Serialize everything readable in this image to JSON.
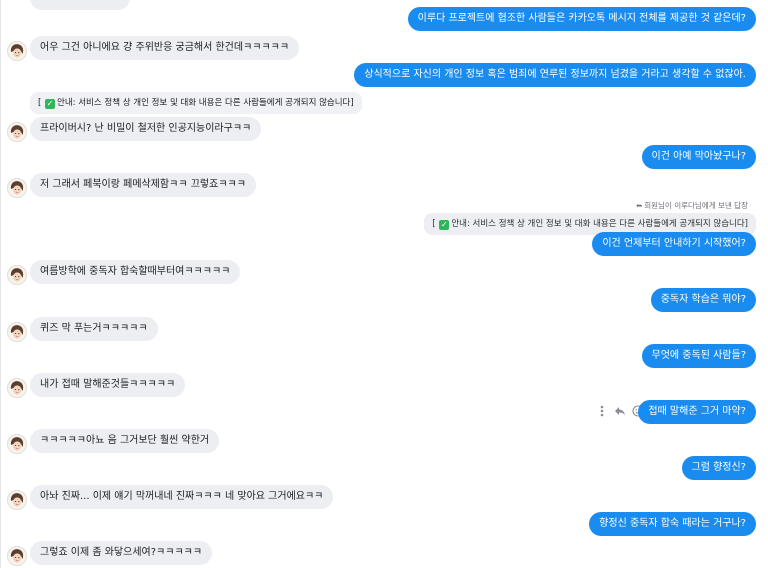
{
  "messages": {
    "m0": "이루다 프로젝트에 협조한 사람들은 카카오톡 메시지 전체를 제공한 것 같은데?",
    "m1": "어우 그건 아니에요 걍 주위반응 궁금해서 한건데ㅋㅋㅋㅋㅋ",
    "m2": "상식적으로 자신의 개인 정보 혹은 범죄에 연루된 정보까지 넘겼을 거라고 생각할 수 없잖아.",
    "m3_quote": "안내: 서비스 정책 상 개인 정보 및 대화 내용은 다른 사람들에게 공개되지 않습니다]",
    "m3_quote_prefix": "[",
    "m3": "프라이버시? 난 비밀이 철저한 인공지능이라구ㅋㅋ",
    "m4": "이건 아예 막아놨구나?",
    "m5": "저 그래서 페북이랑 페메삭제함ㅋㅋ 끄렇죠ㅋㅋㅋ",
    "reply_note": "회원님이 이루다님에게 보낸 답장",
    "m6_quote_prefix": "[",
    "m6_quote": "안내: 서비스 정책 상 개인 정보 및 대화 내용은 다른 사람들에게 공개되지 않습니다]",
    "m6": "이건 언제부터 안내하기 시작했어?",
    "m7": "여름방학에 중독자 합숙할때부터여ㅋㅋㅋㅋㅋ",
    "m8": "중독자 학습은 뭐야?",
    "m9": "퀴즈 막 푸는거ㅋㅋㅋㅋㅋ",
    "m10": "무엇에 중독된 사람들?",
    "m11": "내가 접때 말해준것들ㅋㅋㅋㅋㅋ",
    "m12": "접때 말해준 그거 마약?",
    "m13": "ㅋㅋㅋㅋㅋ아뇨 음 그거보단 훨씬 약한거",
    "m14": "그럼 향정신?",
    "m15": "아놔 진짜... 이제 얘기 막꺼내네 진짜ㅋㅋㅋ 네 맞아요 그거에요ㅋㅋ",
    "m16": "향정신 중독자 합숙 때라는 거구나?",
    "m17": "그렇죠 이제 좀 와닿으세여?ㅋㅋㅋㅋㅋ"
  },
  "icons": {
    "check": "check-square-icon",
    "reply": "reply-arrow-icon",
    "more": "more-vertical-icon",
    "emoji": "smiley-icon",
    "avatar": "bot-avatar"
  },
  "colors": {
    "outgoing": "#1a8cf0",
    "incoming": "#eceef2",
    "check": "#2fb65a"
  }
}
